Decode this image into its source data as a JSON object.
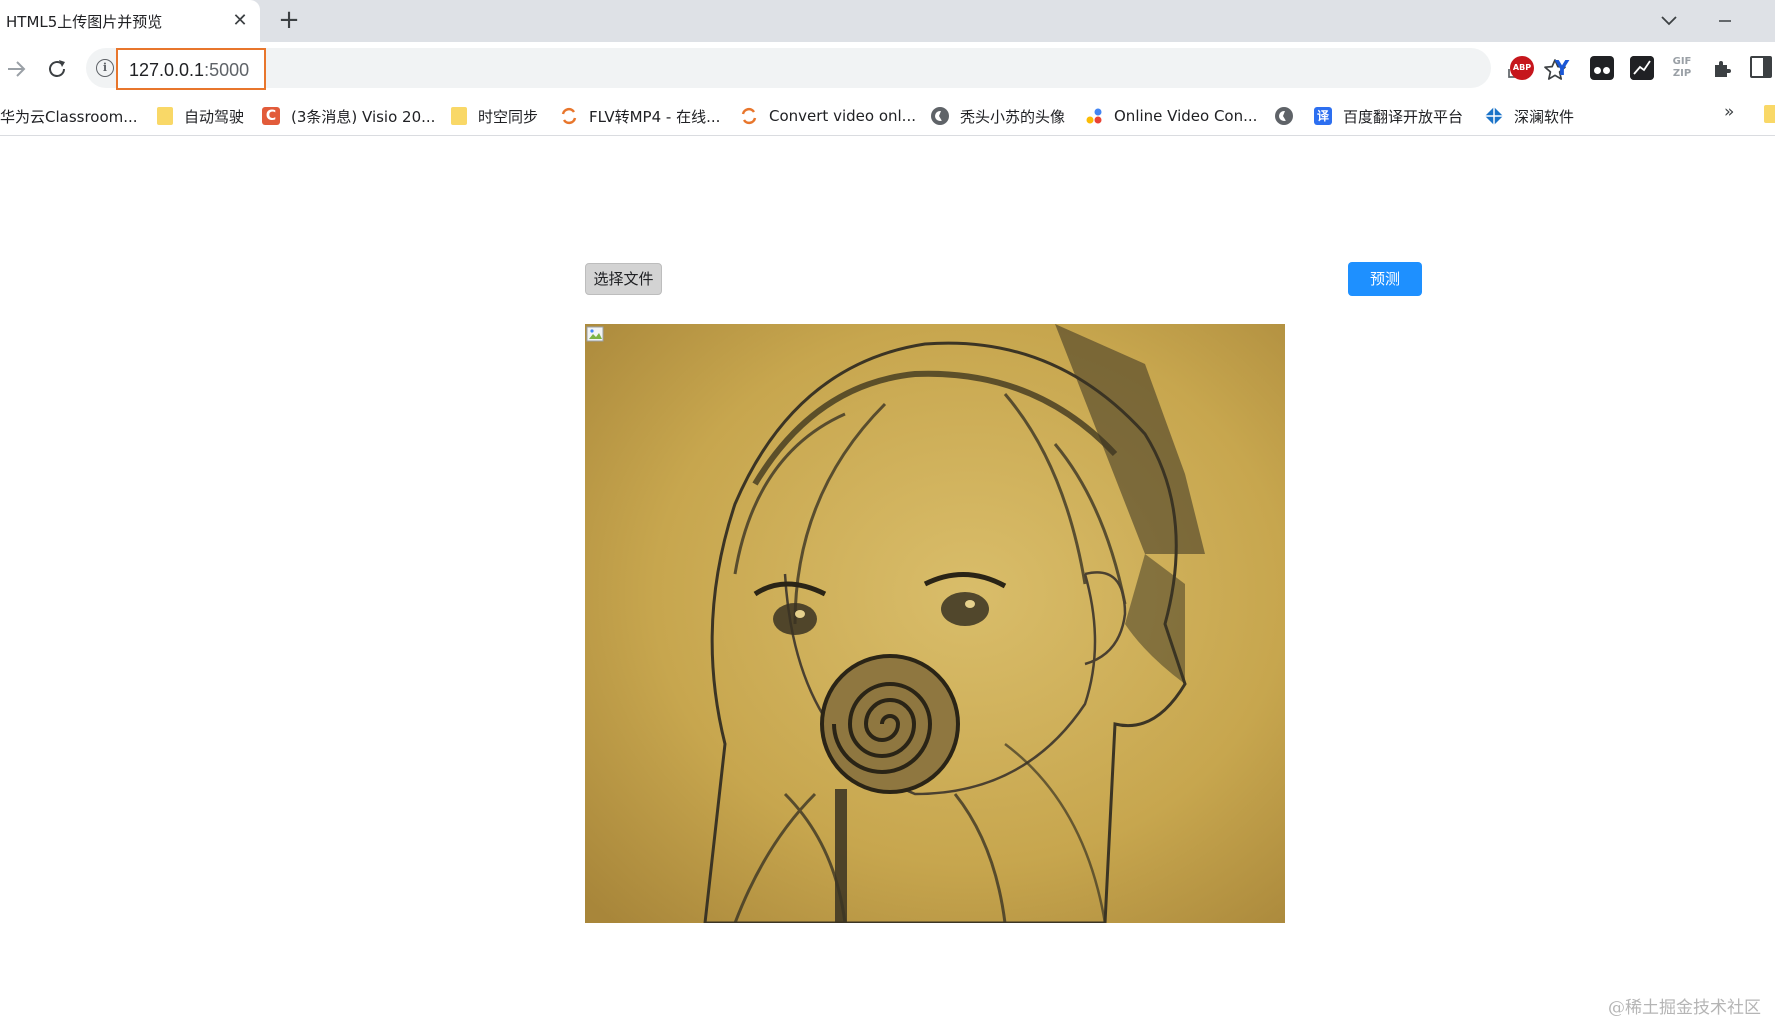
{
  "browser": {
    "tab": {
      "title": "HTML5上传图片并预览",
      "close": "✕"
    },
    "new_tab": "+",
    "address": {
      "host": "127.0.0.1",
      "port": ":5000"
    },
    "extensions": {
      "abp": "ABP",
      "y": "Y",
      "gif": "GIF\nZIP"
    }
  },
  "bookmarks": [
    {
      "label": "华为云Classroom...",
      "icon": "none"
    },
    {
      "label": "自动驾驶",
      "icon": "folder"
    },
    {
      "label": "(3条消息) Visio 20...",
      "icon": "csdn",
      "glyph": "C"
    },
    {
      "label": "时空同步",
      "icon": "folder"
    },
    {
      "label": "FLV转MP4 - 在线...",
      "icon": "convert"
    },
    {
      "label": "Convert video onl...",
      "icon": "convert"
    },
    {
      "label": "秃头小苏的头像",
      "icon": "globe"
    },
    {
      "label": "Online Video Con...",
      "icon": "dots"
    },
    {
      "label": "",
      "icon": "globe"
    },
    {
      "label": "百度翻译开放平台",
      "icon": "translate",
      "glyph": "译"
    },
    {
      "label": "深澜软件",
      "icon": "srun"
    }
  ],
  "bookmarks_overflow": "»",
  "page": {
    "file_button": "选择文件",
    "predict_button": "预测",
    "preview": {
      "subject": "pencil sketch of anime girl holding a lollipop on yellowed paper"
    },
    "watermark": "@稀土掘金技术社区"
  },
  "colors": {
    "predict_button": "#1e90ff",
    "url_highlight": "#e8762c",
    "paper": "#c9a84f"
  }
}
